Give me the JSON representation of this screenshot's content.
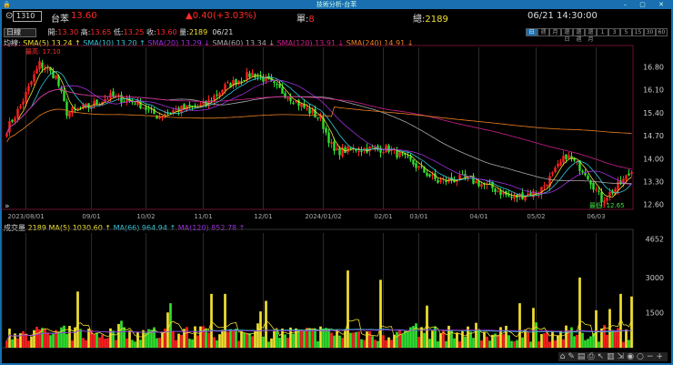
{
  "window": {
    "title": "技術分析-台苯"
  },
  "quote": {
    "code": "1310",
    "name": "台苯",
    "price": "13.60",
    "change": "▲0.40(+3.03%)",
    "single_label": "單:",
    "single": "8",
    "total_label": "總:",
    "total": "2189",
    "datetime": "06/21 14:30:00"
  },
  "ohlc": {
    "period": "日線",
    "open_label": "開:",
    "open": "13.30",
    "high_label": "高:",
    "high": "13.65",
    "low_label": "低:",
    "low": "13.25",
    "close_label": "收:",
    "close": "13.60",
    "vol_label": "量:",
    "vol": "2189",
    "date": "06/21"
  },
  "periods": [
    "日",
    "週",
    "月",
    "還日",
    "還週",
    "還月",
    "1",
    "3",
    "5",
    "15",
    "30",
    "60"
  ],
  "ma_legend": {
    "label": "均線:",
    "items": [
      {
        "text": "SMA(5) 13.24 ↑",
        "color": "#f0e030"
      },
      {
        "text": "SMA(10) 13.20 ↑",
        "color": "#30c8d8"
      },
      {
        "text": "SMA(20) 13.29 ↓",
        "color": "#a030e0"
      },
      {
        "text": "SMA(60) 13.34 ↓",
        "color": "#aaaaaa"
      },
      {
        "text": "SMA(120) 13.91 ↓",
        "color": "#d02090"
      },
      {
        "text": "SMA(240) 14.91 ↓",
        "color": "#f08020"
      }
    ]
  },
  "vol_legend": {
    "label": "成交量",
    "value": "2189",
    "items": [
      {
        "text": "MA(5) 1030.60 ↑",
        "color": "#f0e030"
      },
      {
        "text": "MA(66) 964.94 ↑",
        "color": "#30c8d8"
      },
      {
        "text": "MA(120) 852.78 ↑",
        "color": "#a030e0"
      }
    ]
  },
  "annotations": {
    "high": "最高: 17.10",
    "low": "最低: 12.65"
  },
  "toolbar": "⌂✎▤⎙↖▥⇲◉○−+",
  "chart_data": {
    "type": "candlestick",
    "price_ticks": [
      "16.80",
      "16.10",
      "15.40",
      "14.70",
      "14.00",
      "13.30",
      "12.60"
    ],
    "price_tick_values": [
      16.8,
      16.1,
      15.4,
      14.7,
      14.0,
      13.3,
      12.6
    ],
    "ylim": [
      12.45,
      17.4
    ],
    "date_ticks": [
      "2023/08/01",
      "09/01",
      "10/02",
      "11/01",
      "12/01",
      "2024/01/02",
      "02/01",
      "03/01",
      "04/01",
      "05/02",
      "06/03"
    ],
    "date_tick_index": [
      7,
      31,
      51,
      72,
      94,
      116,
      138,
      151,
      173,
      194,
      216
    ],
    "vol_ticks": [
      "4652",
      "3000",
      "1500"
    ],
    "vol_tick_values": [
      4652,
      3000,
      1500
    ],
    "bar_count": 230,
    "close_keypoints": [
      [
        0,
        14.9
      ],
      [
        5,
        15.6
      ],
      [
        12,
        16.9
      ],
      [
        18,
        16.5
      ],
      [
        22,
        15.4
      ],
      [
        30,
        15.6
      ],
      [
        38,
        15.9
      ],
      [
        48,
        15.7
      ],
      [
        55,
        15.3
      ],
      [
        62,
        15.5
      ],
      [
        72,
        15.6
      ],
      [
        80,
        16.2
      ],
      [
        90,
        16.6
      ],
      [
        95,
        16.4
      ],
      [
        105,
        15.8
      ],
      [
        115,
        15.2
      ],
      [
        120,
        14.2
      ],
      [
        128,
        14.3
      ],
      [
        140,
        14.3
      ],
      [
        148,
        13.9
      ],
      [
        158,
        13.3
      ],
      [
        168,
        13.4
      ],
      [
        178,
        13.1
      ],
      [
        185,
        12.8
      ],
      [
        195,
        13.0
      ],
      [
        200,
        13.5
      ],
      [
        205,
        14.1
      ],
      [
        212,
        13.6
      ],
      [
        218,
        12.75
      ],
      [
        222,
        13.0
      ],
      [
        229,
        13.6
      ]
    ],
    "volume_spikes": [
      [
        26,
        2400
      ],
      [
        60,
        1900
      ],
      [
        75,
        2300
      ],
      [
        80,
        2300
      ],
      [
        95,
        2000
      ],
      [
        125,
        3300
      ],
      [
        137,
        2900
      ],
      [
        154,
        1800
      ],
      [
        188,
        1900
      ],
      [
        193,
        1700
      ],
      [
        210,
        3000
      ],
      [
        216,
        1600
      ],
      [
        225,
        2300
      ],
      [
        229,
        2189
      ]
    ]
  }
}
